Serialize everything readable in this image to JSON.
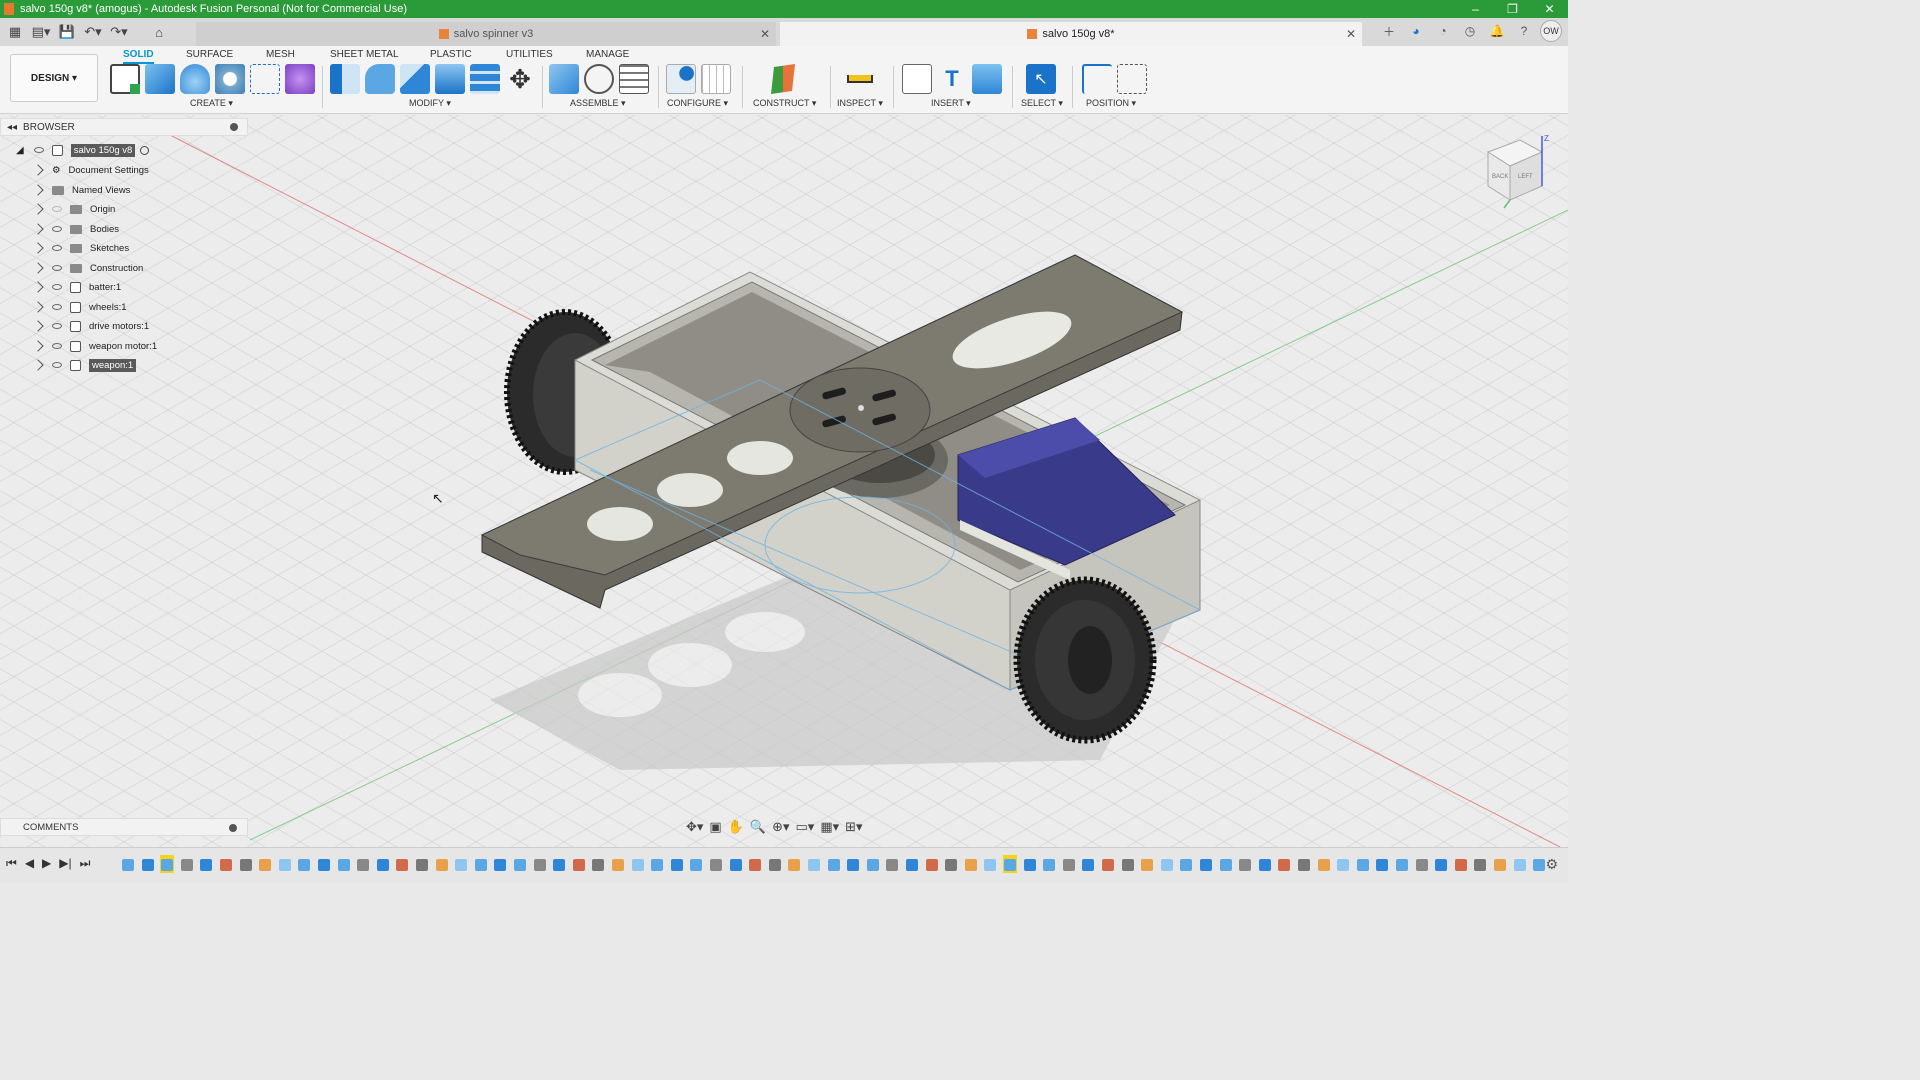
{
  "window": {
    "title": "salvo 150g v8* (amogus) - Autodesk Fusion Personal (Not for Commercial Use)",
    "controls": [
      "–",
      "❐",
      "✕"
    ]
  },
  "tabs": {
    "inactive": "salvo spinner v3",
    "active": "salvo 150g v8*"
  },
  "user_initials": "OW",
  "ribbon": {
    "workspace": "DESIGN ▾",
    "tabs": [
      "SOLID",
      "SURFACE",
      "MESH",
      "SHEET METAL",
      "PLASTIC",
      "UTILITIES",
      "MANAGE"
    ],
    "groups": [
      "CREATE ▾",
      "MODIFY ▾",
      "ASSEMBLE ▾",
      "CONFIGURE ▾",
      "CONSTRUCT ▾",
      "INSPECT ▾",
      "INSERT ▾",
      "SELECT ▾",
      "POSITION ▾"
    ]
  },
  "browser": {
    "title": "BROWSER",
    "root": "salvo 150g v8",
    "items": [
      {
        "label": "Document Settings",
        "icon": "gear-icon"
      },
      {
        "label": "Named Views",
        "icon": "folder-icon"
      },
      {
        "label": "Origin",
        "icon": "folder-icon"
      },
      {
        "label": "Bodies",
        "icon": "folder-icon"
      },
      {
        "label": "Sketches",
        "icon": "folder-icon"
      },
      {
        "label": "Construction",
        "icon": "folder-icon"
      },
      {
        "label": "batter:1",
        "icon": "component-icon"
      },
      {
        "label": "wheels:1",
        "icon": "component-icon"
      },
      {
        "label": "drive motors:1",
        "icon": "component-icon"
      },
      {
        "label": "weapon motor:1",
        "icon": "component-icon"
      },
      {
        "label": "weapon:1",
        "icon": "component-icon",
        "selected": true
      }
    ]
  },
  "comments": {
    "title": "COMMENTS"
  },
  "viewcube": {
    "faces": [
      "BACK",
      "LEFT"
    ],
    "axis": "Z"
  }
}
